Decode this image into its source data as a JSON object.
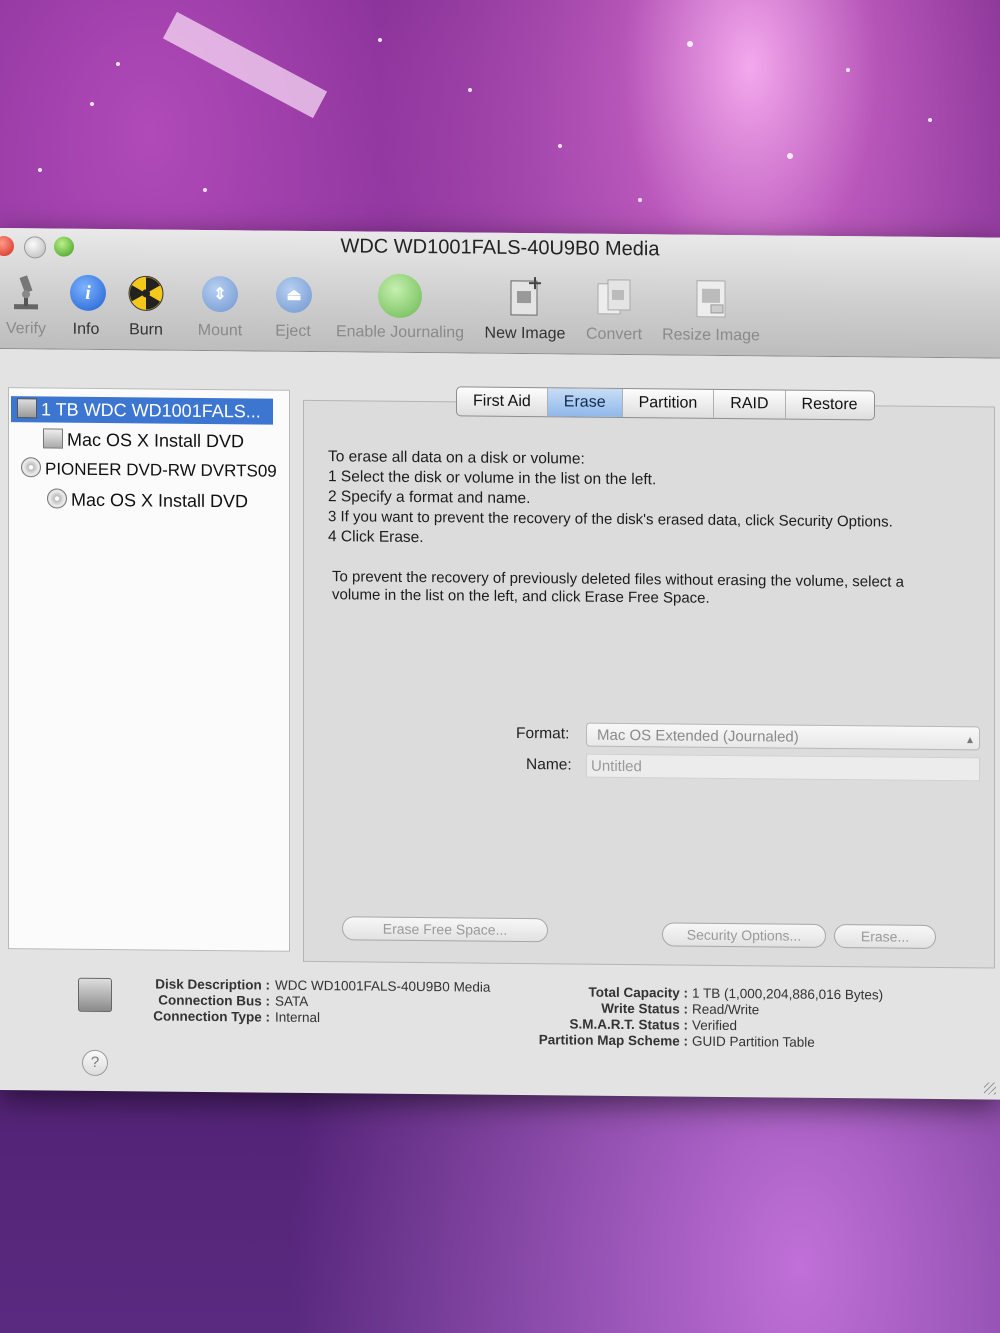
{
  "window": {
    "title": "WDC WD1001FALS-40U9B0 Media"
  },
  "toolbar": {
    "items": [
      {
        "label": "Verify",
        "icon": "microscope-icon",
        "enabled": false
      },
      {
        "label": "Info",
        "icon": "info-icon",
        "enabled": true
      },
      {
        "label": "Burn",
        "icon": "burn-icon",
        "enabled": true
      },
      {
        "label": "Mount",
        "icon": "mount-icon",
        "enabled": false
      },
      {
        "label": "Eject",
        "icon": "eject-icon",
        "enabled": false
      },
      {
        "label": "Enable Journaling",
        "icon": "journaling-icon",
        "enabled": false
      },
      {
        "label": "New Image",
        "icon": "new-image-icon",
        "enabled": true
      },
      {
        "label": "Convert",
        "icon": "convert-icon",
        "enabled": false
      },
      {
        "label": "Resize Image",
        "icon": "resize-image-icon",
        "enabled": false
      }
    ]
  },
  "sidebar": {
    "items": [
      {
        "label": "1 TB WDC WD1001FALS...",
        "icon": "hard-disk-icon",
        "selected": true
      },
      {
        "label": "Mac OS X Install DVD",
        "icon": "volume-icon",
        "selected": false
      },
      {
        "label": "PIONEER DVD-RW DVRTS09",
        "icon": "optical-drive-icon",
        "selected": false
      },
      {
        "label": "Mac OS X Install DVD",
        "icon": "dvd-icon",
        "selected": false
      }
    ]
  },
  "tabs": [
    {
      "label": "First Aid",
      "active": false
    },
    {
      "label": "Erase",
      "active": true
    },
    {
      "label": "Partition",
      "active": false
    },
    {
      "label": "RAID",
      "active": false
    },
    {
      "label": "Restore",
      "active": false
    }
  ],
  "erase": {
    "instructions": [
      "To erase all data on a disk or volume:",
      "1 Select the disk or volume in the list on the left.",
      "2 Specify a format and name.",
      "3 If you want to prevent the recovery of the disk's erased data, click Security Options.",
      "4 Click Erase."
    ],
    "free_space_note": [
      "To prevent the recovery of previously deleted files without erasing the volume, select a",
      "volume in the list on the left, and click Erase Free Space."
    ],
    "format_label": "Format:",
    "format_value": "Mac OS Extended (Journaled)",
    "name_label": "Name:",
    "name_value": "Untitled",
    "erase_free_space_button": "Erase Free Space...",
    "security_options_button": "Security Options...",
    "erase_button": "Erase..."
  },
  "disk_info": {
    "left": [
      {
        "label": "Disk Description :",
        "value": "WDC WD1001FALS-40U9B0 Media"
      },
      {
        "label": "Connection Bus :",
        "value": "SATA"
      },
      {
        "label": "Connection Type :",
        "value": "Internal"
      }
    ],
    "right": [
      {
        "label": "Total Capacity :",
        "value": "1 TB (1,000,204,886,016 Bytes)"
      },
      {
        "label": "Write Status :",
        "value": "Read/Write"
      },
      {
        "label": "S.M.A.R.T. Status :",
        "value": "Verified"
      },
      {
        "label": "Partition Map Scheme :",
        "value": "GUID Partition Table"
      }
    ],
    "help": "?"
  },
  "colors": {
    "selection": "#3d76d1",
    "tab_active": "#8fb8ea",
    "desktop": "#6b1f80"
  }
}
